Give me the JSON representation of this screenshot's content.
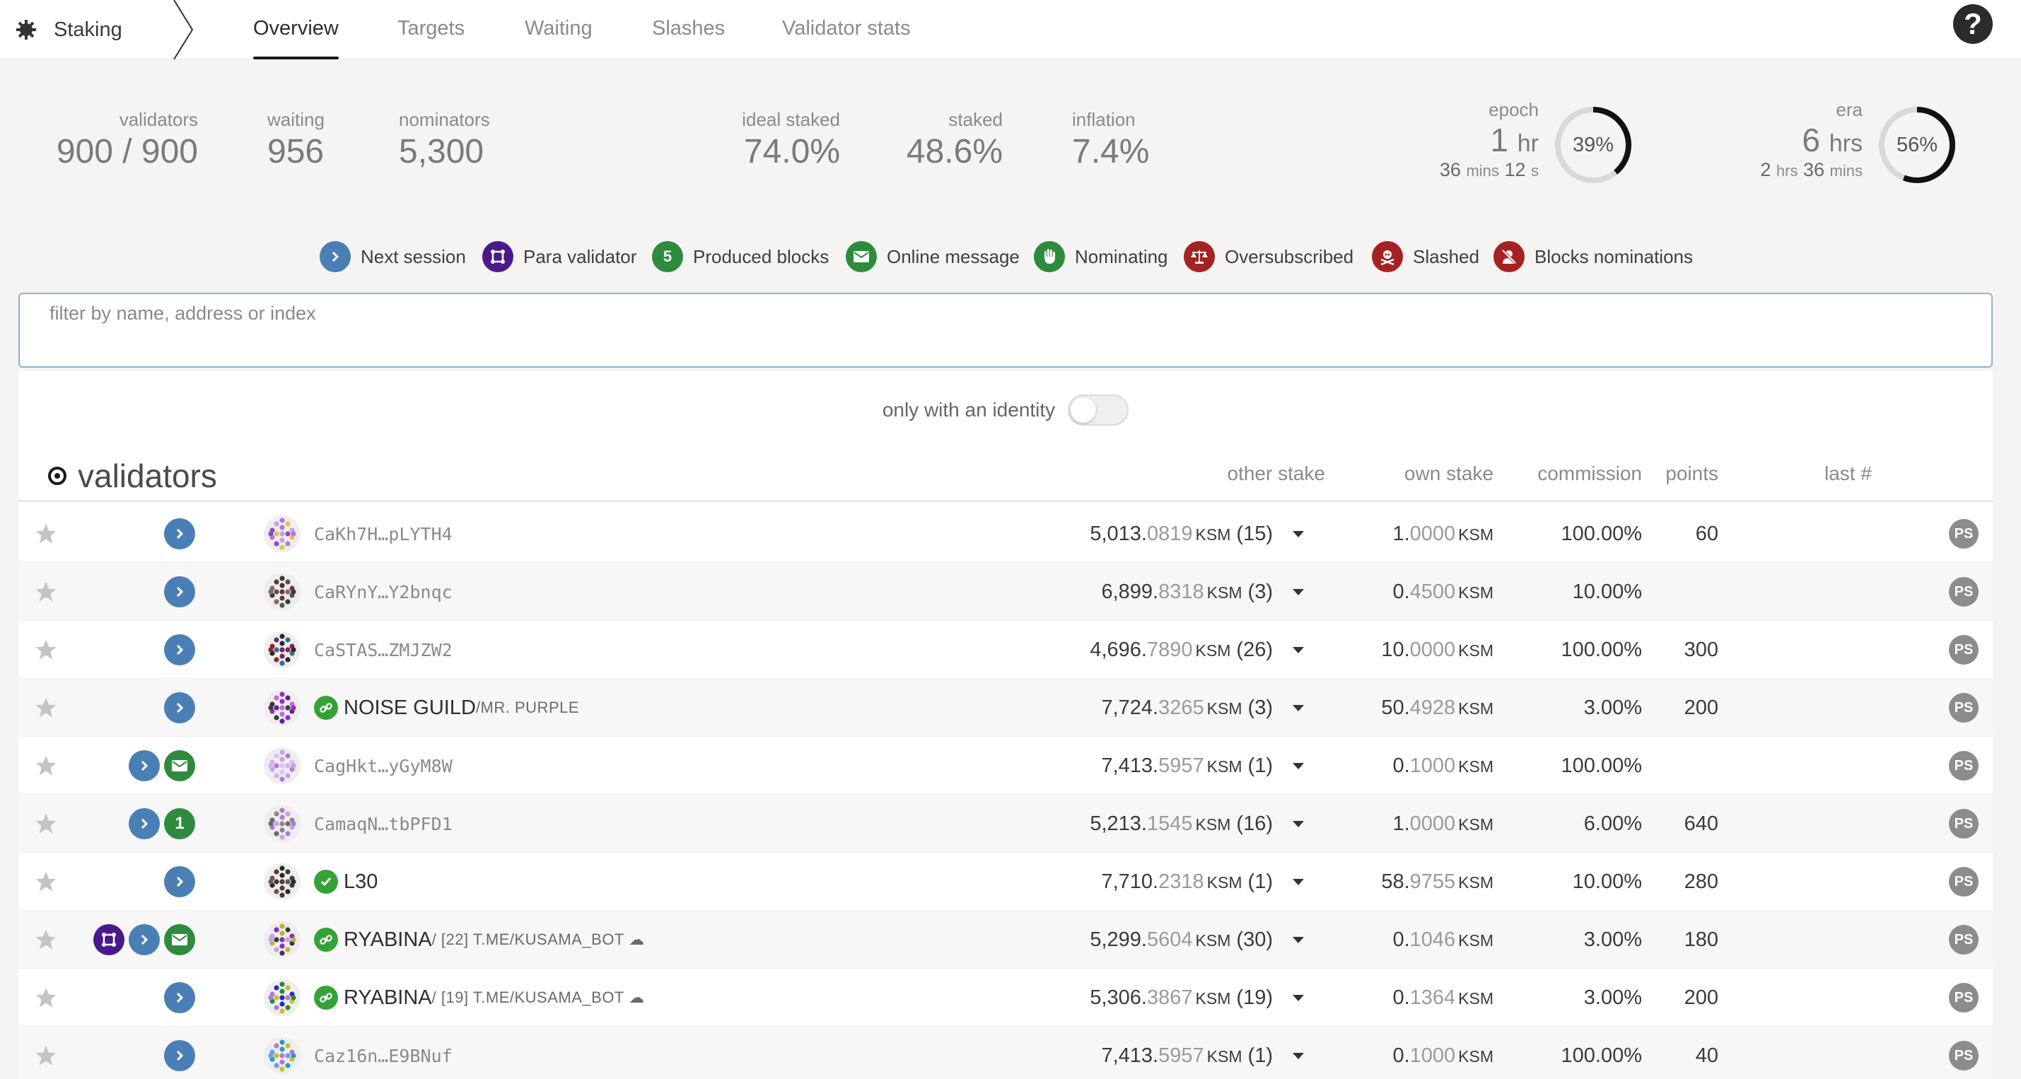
{
  "nav": {
    "brand": "Staking",
    "tabs": [
      {
        "label": "Overview",
        "active": true
      },
      {
        "label": "Targets"
      },
      {
        "label": "Waiting"
      },
      {
        "label": "Slashes"
      },
      {
        "label": "Validator stats"
      }
    ],
    "help_icon": "question-circle-icon"
  },
  "summary": {
    "validators": {
      "label": "validators",
      "value": "900 / 900"
    },
    "waiting": {
      "label": "waiting",
      "value": "956"
    },
    "nominators": {
      "label": "nominators",
      "value": "5,300"
    },
    "ideal_staked": {
      "label": "ideal staked",
      "value": "74.0%"
    },
    "staked": {
      "label": "staked",
      "value": "48.6%"
    },
    "inflation": {
      "label": "inflation",
      "value": "7.4%"
    },
    "epoch": {
      "label": "epoch",
      "big_num": "1",
      "big_unit": "hr",
      "sub1_num": "36",
      "sub1_unit": "mins",
      "sub2_num": "12",
      "sub2_unit": "s",
      "percent": "39%",
      "fraction": 0.39
    },
    "era": {
      "label": "era",
      "big_num": "6",
      "big_unit": "hrs",
      "sub1_num": "2",
      "sub1_unit": "hrs",
      "sub2_num": "36",
      "sub2_unit": "mins",
      "percent": "56%",
      "fraction": 0.56
    }
  },
  "legend": [
    {
      "label": "Next session",
      "icon": "chevron-right-icon",
      "color": "#4a7fb5"
    },
    {
      "label": "Para validator",
      "icon": "para-chain-icon",
      "color": "#4a1a8c"
    },
    {
      "label": "Produced blocks",
      "icon_text": "5",
      "color": "#2e8b3e"
    },
    {
      "label": "Online message",
      "icon": "envelope-icon",
      "color": "#2e8b3e"
    },
    {
      "label": "Nominating",
      "icon": "hand-icon",
      "color": "#2e8b3e"
    },
    {
      "label": "Oversubscribed",
      "icon": "balance-scale-icon",
      "color": "#a62222"
    },
    {
      "label": "Slashed",
      "icon": "skull-crossbones-icon",
      "color": "#a62222"
    },
    {
      "label": "Blocks nominations",
      "icon": "user-slash-icon",
      "color": "#a62222"
    }
  ],
  "filter": {
    "placeholder": "filter by name, address or index"
  },
  "identity_toggle": {
    "label": "only with an identity",
    "on": false
  },
  "table": {
    "title": "validators",
    "headers": {
      "other_stake": "other stake",
      "own_stake": "own stake",
      "commission": "commission",
      "points": "points",
      "last": "last #"
    },
    "rows": [
      {
        "badges": [
          "next"
        ],
        "name_type": "address",
        "address": "CaKh7H…pLYTH4",
        "other_int": "5,013.",
        "other_frac": "0819",
        "other_unit": "KSM",
        "other_count": "(15)",
        "own_int": "1.",
        "own_frac": "0000",
        "own_unit": "KSM",
        "commission": "100.00%",
        "points": "60",
        "ps": "PS",
        "avatar_colors": [
          "#b07ad6",
          "#c9a0e8",
          "#e8c14a",
          "#8e4fc2"
        ]
      },
      {
        "badges": [
          "next"
        ],
        "name_type": "address",
        "address": "CaRYnY…Y2bnqc",
        "other_int": "6,899.",
        "other_frac": "8318",
        "other_unit": "KSM",
        "other_count": "(3)",
        "own_int": "0.",
        "own_frac": "4500",
        "own_unit": "KSM",
        "commission": "10.00%",
        "points": "",
        "ps": "PS",
        "avatar_colors": [
          "#3a3a3a",
          "#6a3a2a",
          "#555555",
          "#8a6a5a"
        ]
      },
      {
        "badges": [
          "next"
        ],
        "name_type": "address",
        "address": "CaSTAS…ZMJZW2",
        "other_int": "4,696.",
        "other_frac": "7890",
        "other_unit": "KSM",
        "other_count": "(26)",
        "own_int": "10.",
        "own_frac": "0000",
        "own_unit": "KSM",
        "commission": "100.00%",
        "points": "300",
        "ps": "PS",
        "avatar_colors": [
          "#2a2a2a",
          "#6a2a6a",
          "#3a6a8a",
          "#8a2a2a"
        ]
      },
      {
        "badges": [
          "next"
        ],
        "name_type": "identity",
        "name": "NOISE GUILD",
        "sub": "/MR. PURPLE",
        "other_int": "7,724.",
        "other_frac": "3265",
        "other_unit": "KSM",
        "other_count": "(3)",
        "own_int": "50.",
        "own_frac": "4928",
        "own_unit": "KSM",
        "commission": "3.00%",
        "points": "200",
        "ps": "PS",
        "avatar_colors": [
          "#9a2ac2",
          "#c26ae0",
          "#6a1a9a",
          "#3a3a3a"
        ]
      },
      {
        "badges": [
          "next",
          "online"
        ],
        "name_type": "address",
        "address": "CagHkt…yGyM8W",
        "other_int": "7,413.",
        "other_frac": "5957",
        "other_unit": "KSM",
        "other_count": "(1)",
        "own_int": "0.",
        "own_frac": "1000",
        "own_unit": "KSM",
        "commission": "100.00%",
        "points": "",
        "ps": "PS",
        "avatar_colors": [
          "#c9a0e8",
          "#e0c0f0",
          "#b07ad6",
          "#d8b0ec"
        ]
      },
      {
        "badges": [
          "next",
          "produced"
        ],
        "produced_count": "1",
        "name_type": "address",
        "address": "CamaqN…tbPFD1",
        "other_int": "5,213.",
        "other_frac": "1545",
        "other_unit": "KSM",
        "other_count": "(16)",
        "own_int": "1.",
        "own_frac": "0000",
        "own_unit": "KSM",
        "commission": "6.00%",
        "points": "640",
        "ps": "PS",
        "avatar_colors": [
          "#b07ad6",
          "#8a8a8a",
          "#c9a0e8",
          "#6a6a6a"
        ]
      },
      {
        "badges": [
          "next"
        ],
        "name_type": "identity_verified",
        "name": "L30",
        "sub": "",
        "other_int": "7,710.",
        "other_frac": "2318",
        "other_unit": "KSM",
        "other_count": "(1)",
        "own_int": "58.",
        "own_frac": "9755",
        "own_unit": "KSM",
        "commission": "10.00%",
        "points": "280",
        "ps": "PS",
        "avatar_colors": [
          "#2a2a2a",
          "#5a3a2a",
          "#3a3a3a",
          "#6a5a4a"
        ]
      },
      {
        "badges": [
          "para",
          "next",
          "online"
        ],
        "name_type": "identity",
        "name": "RYABINA",
        "sub": "/ [22] T.ME/KUSAMA_BOT ☁",
        "other_int": "5,299.",
        "other_frac": "5604",
        "other_unit": "KSM",
        "other_count": "(30)",
        "own_int": "0.",
        "own_frac": "1046",
        "own_unit": "KSM",
        "commission": "3.00%",
        "points": "180",
        "ps": "PS",
        "avatar_colors": [
          "#c2b02a",
          "#8a2ac2",
          "#3a3a3a",
          "#c9a0e8"
        ]
      },
      {
        "badges": [
          "next"
        ],
        "name_type": "identity",
        "name": "RYABINA",
        "sub": "/ [19] T.ME/KUSAMA_BOT ☁",
        "other_int": "5,306.",
        "other_frac": "3867",
        "other_unit": "KSM",
        "other_count": "(19)",
        "own_int": "0.",
        "own_frac": "1364",
        "own_unit": "KSM",
        "commission": "3.00%",
        "points": "200",
        "ps": "PS",
        "avatar_colors": [
          "#2a8a2a",
          "#2a2ac2",
          "#c2c22a",
          "#b07ad6"
        ]
      },
      {
        "badges": [
          "next"
        ],
        "name_type": "address",
        "address": "Caz16n…E9BNuf",
        "other_int": "7,413.",
        "other_frac": "5957",
        "other_unit": "KSM",
        "other_count": "(1)",
        "own_int": "0.",
        "own_frac": "1000",
        "own_unit": "KSM",
        "commission": "100.00%",
        "points": "40",
        "ps": "PS",
        "avatar_colors": [
          "#2a9ac2",
          "#b07ad6",
          "#c2c22a",
          "#6aa0e0"
        ]
      }
    ]
  }
}
